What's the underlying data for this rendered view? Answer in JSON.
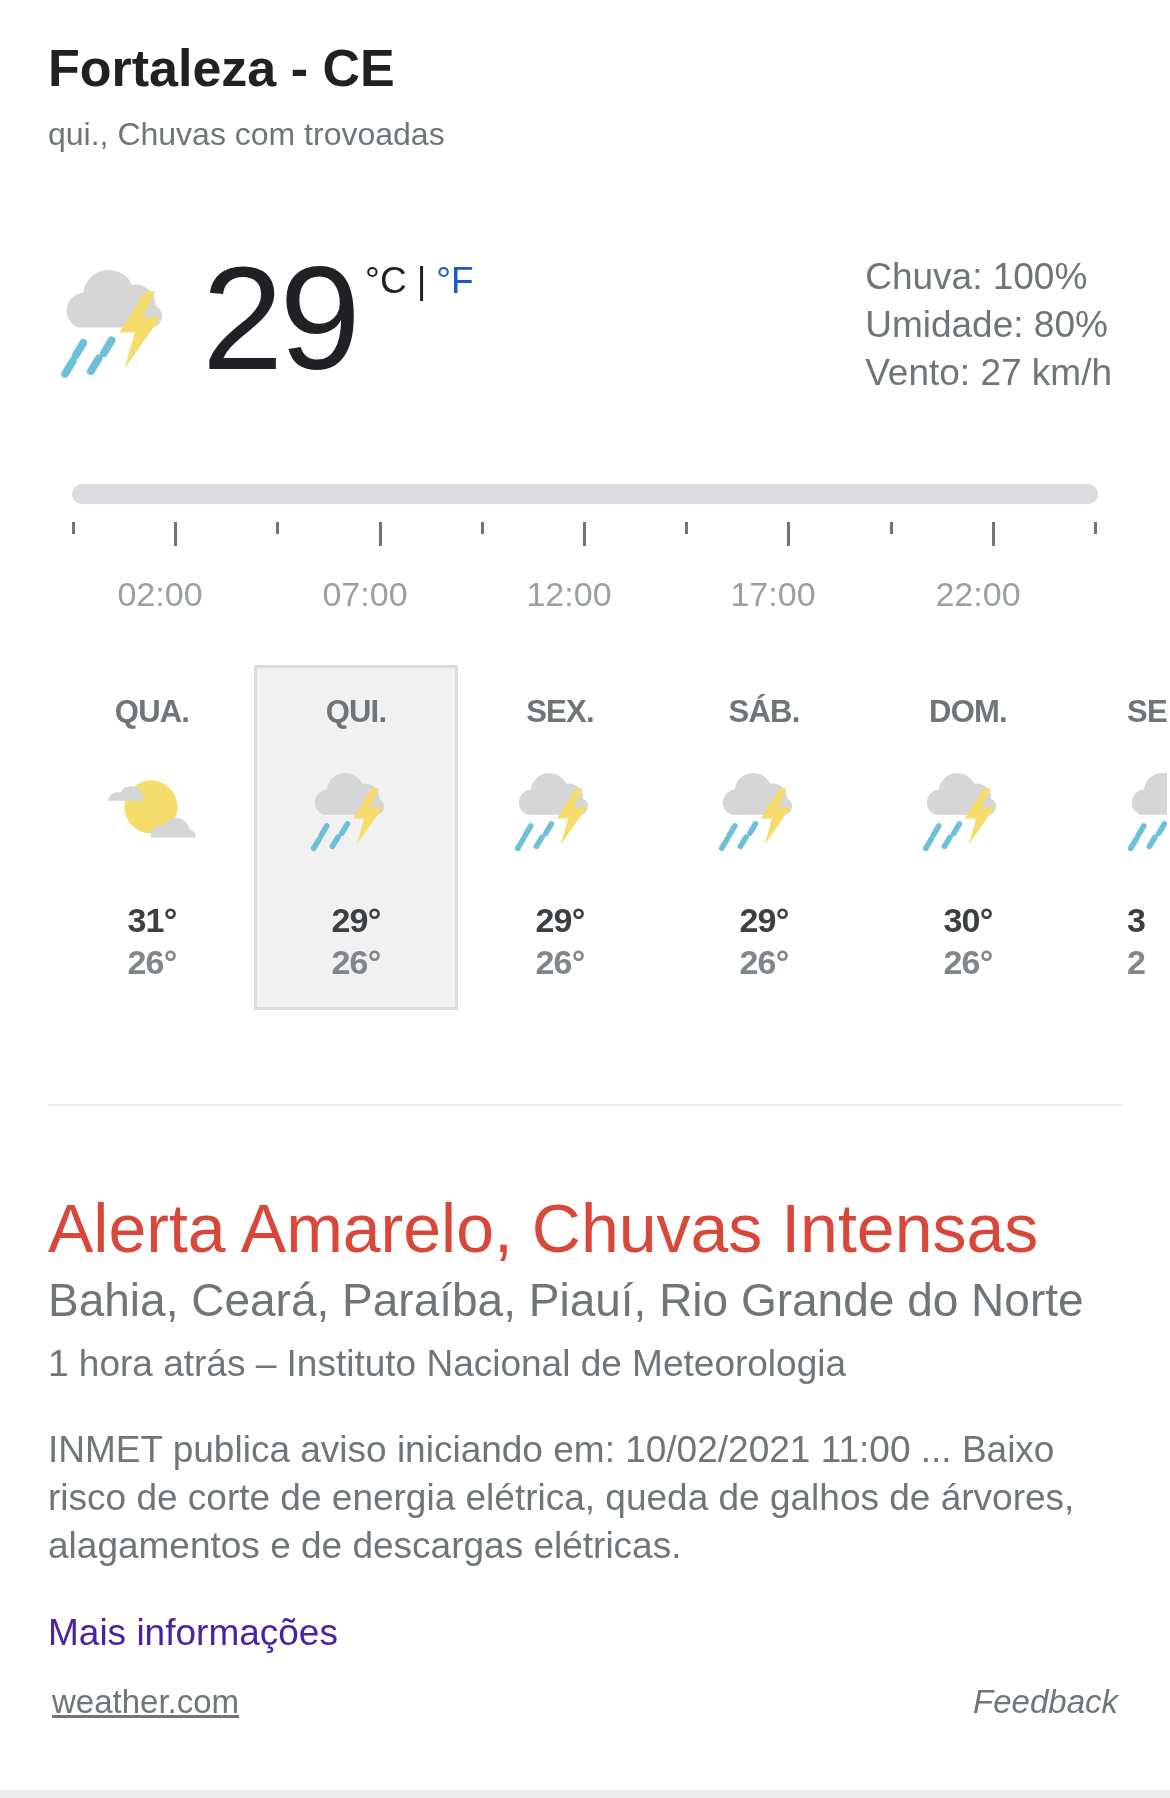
{
  "location": {
    "title": "Fortaleza - CE",
    "subtitle": "qui., Chuvas com trovoadas"
  },
  "current": {
    "kind": "storm",
    "temperature": "29",
    "units": [
      {
        "label": "°C",
        "selected": true
      },
      {
        "label": "°F",
        "selected": false
      }
    ],
    "separator": "|",
    "details": [
      "Chuva: 100%",
      "Umidade: 80%",
      "Vento: 27 km/h"
    ]
  },
  "timeline": {
    "labels": [
      "02:00",
      "07:00",
      "12:00",
      "17:00",
      "22:00"
    ]
  },
  "days": [
    {
      "day": "QUA.",
      "kind": "partly_cloudy",
      "high": "31°",
      "low": "26°",
      "selected": false
    },
    {
      "day": "QUI.",
      "kind": "storm",
      "high": "29°",
      "low": "26°",
      "selected": true
    },
    {
      "day": "SEX.",
      "kind": "storm",
      "high": "29°",
      "low": "26°",
      "selected": false
    },
    {
      "day": "SÁB.",
      "kind": "storm",
      "high": "29°",
      "low": "26°",
      "selected": false
    },
    {
      "day": "DOM.",
      "kind": "storm",
      "high": "30°",
      "low": "26°",
      "selected": false
    },
    {
      "day": "SE",
      "kind": "storm",
      "high": "3",
      "low": "2",
      "selected": false,
      "cut": true
    }
  ],
  "alert": {
    "title": "Alerta Amarelo, Chuvas Intensas",
    "regions": "Bahia, Ceará, Paraíba, Piauí, Rio Grande do Norte",
    "meta": "1 hora atrás – Instituto Nacional de Meteorologia",
    "body": "INMET publica aviso iniciando em: 10/02/2021 11:00 ... Baixo risco de corte de energia elétrica, queda de galhos de árvores, alagamentos e de descargas elétricas.",
    "link": "Mais informações"
  },
  "footer": {
    "source": "weather.com",
    "feedback": "Feedback"
  }
}
